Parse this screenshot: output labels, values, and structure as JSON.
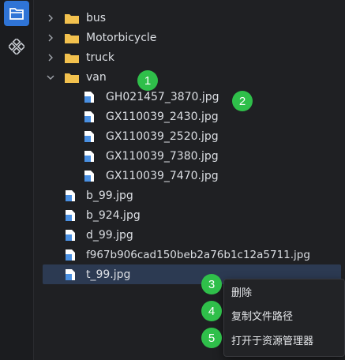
{
  "activity_bar": {
    "items": [
      {
        "icon": "explorer-icon",
        "active": true
      },
      {
        "icon": "extensions-icon",
        "active": false
      }
    ]
  },
  "tree": {
    "folders": [
      {
        "name": "bus",
        "expanded": false
      },
      {
        "name": "Motorbicycle",
        "expanded": false
      },
      {
        "name": "truck",
        "expanded": false
      },
      {
        "name": "van",
        "expanded": true
      }
    ],
    "van_files": [
      "GH021457_3870.jpg",
      "GX110039_2430.jpg",
      "GX110039_2520.jpg",
      "GX110039_7380.jpg",
      "GX110039_7470.jpg"
    ],
    "root_files": [
      "b_99.jpg",
      "b_924.jpg",
      "d_99.jpg",
      "f967b906cad150beb2a76b1c12a5711.jpg",
      "t_99.jpg"
    ],
    "selected_file": "t_99.jpg"
  },
  "context_menu": {
    "items": [
      "删除",
      "复制文件路径",
      "打开于资源管理器"
    ]
  },
  "badges": [
    "1",
    "2",
    "3",
    "4",
    "5"
  ],
  "colors": {
    "background": "#1f2023",
    "folder": "#f2c14e",
    "file": "#4a90e2",
    "selection": "#2c3a52",
    "badge": "#2fbf4a",
    "accent": "#2f74d6"
  }
}
